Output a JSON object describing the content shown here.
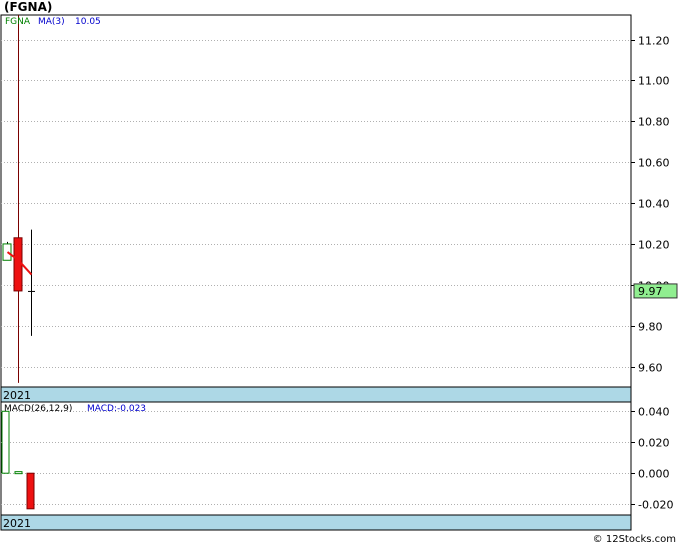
{
  "header": {
    "title": "(FGNA)"
  },
  "legend": {
    "symbol": "FGNA",
    "ma_label": "MA(3)",
    "ma_value": "10.05",
    "macd_label": "MACD(26,12,9)",
    "macd_value_label": "MACD:-0.023"
  },
  "price_tag": "9.97",
  "footer": {
    "credit": "© 12Stocks.com"
  },
  "colors": {
    "up": "#ffffff",
    "down": "#ee1111",
    "ma_line": "#ee1111",
    "macd_up": "#ffffff",
    "macd_down": "#ee1111",
    "year_band": "#add8e6",
    "price_tag_bg": "#90ee90",
    "grid": "#b0b0b0",
    "legend_symbol": "#008000",
    "legend_ma": "#0000cc"
  },
  "chart_data": [
    {
      "type": "candlestick",
      "title": "(FGNA)",
      "year_label": "2021",
      "ylim": [
        9.5,
        11.32
      ],
      "yticks": [
        9.6,
        9.8,
        10.0,
        10.2,
        10.4,
        10.6,
        10.8,
        11.0,
        11.2
      ],
      "ytick_labels": [
        "9.60",
        "9.80",
        "10.00",
        "10.20",
        "10.40",
        "10.60",
        "10.80",
        "11.00",
        "11.20"
      ],
      "candles": [
        {
          "open": 10.12,
          "high": 10.21,
          "low": 10.12,
          "close": 10.2
        },
        {
          "open": 10.23,
          "high": 11.42,
          "low": 9.52,
          "close": 9.97
        },
        {
          "open": 9.97,
          "high": 10.27,
          "low": 9.75,
          "close": 9.97
        }
      ],
      "ma": [
        10.16,
        10.12,
        10.05
      ],
      "last_price": 9.97,
      "grid": true
    },
    {
      "type": "bar",
      "title": "MACD(26,12,9)",
      "year_label": "2021",
      "ylim": [
        -0.027,
        0.046
      ],
      "yticks": [
        -0.02,
        0.0,
        0.02,
        0.04
      ],
      "ytick_labels": [
        "-0.020",
        "0.000",
        "0.020",
        "0.040"
      ],
      "values": [
        0.04,
        0.001,
        -0.023
      ],
      "grid": true
    }
  ]
}
